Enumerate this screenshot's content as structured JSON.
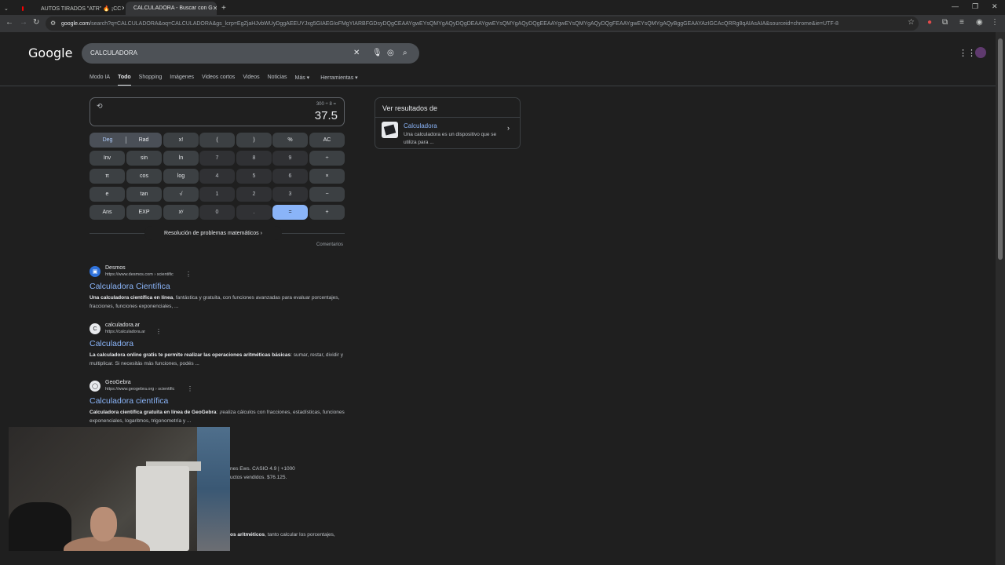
{
  "browser": {
    "tabs": [
      {
        "title": "AUTOS TIRADOS \"ATR\" 🔥 ¡CC"
      },
      {
        "title": "CALCULADORA - Buscar con G"
      }
    ],
    "url_host": "google.com",
    "url_rest": "/search?q=CALCULADORA&oq=CALCULADORA&gs_lcrp=EgZjaHJvbWUyDggAEEUYJxg5GIAEGIoFMgYIARBFGDsyDQgCEAAYgwEYsQMYgAQyDQgDEAAYgwEYsQMYgAQyDQgEEAAYgwEYsQMYgAQyDQgFEAAYgwEYsQMYgAQyBggGEAAYAzIGCAcQRRg8qAIAsAIA&sourceid=chrome&ie=UTF-8"
  },
  "search": {
    "logo": "Google",
    "query": "CALCULADORA"
  },
  "nav_tabs": [
    "Modo IA",
    "Todo",
    "Shopping",
    "Imágenes",
    "Videos cortos",
    "Videos",
    "Noticias",
    "Más ▾",
    "Herramientas ▾"
  ],
  "calculator": {
    "expression": "300 ÷ 8 =",
    "result": "37.5",
    "rows": [
      [
        "Deg",
        "Rad",
        "x!",
        "(",
        ")",
        "%",
        "AC"
      ],
      [
        "Inv",
        "sin",
        "ln",
        "7",
        "8",
        "9",
        "÷"
      ],
      [
        "π",
        "cos",
        "log",
        "4",
        "5",
        "6",
        "×"
      ],
      [
        "e",
        "tan",
        "√",
        "1",
        "2",
        "3",
        "−"
      ],
      [
        "Ans",
        "EXP",
        "xʸ",
        "0",
        ".",
        "=",
        "+"
      ]
    ],
    "solve_label": "Resolución de problemas matemáticos ›",
    "feedback_label": "Comentarios"
  },
  "side_panel": {
    "title": "Ver resultados de",
    "name": "Calculadora",
    "description": "Una calculadora es un dispositivo que se utiliza para ..."
  },
  "results": [
    {
      "site": "Desmos",
      "url": "https://www.desmos.com › scientific",
      "title": "Calculadora Científica",
      "snippet_bold": "Una calculadora científica en línea",
      "snippet_rest": ", fantástica y gratuita, con funciones avanzadas para evaluar porcentajes, fracciones, funciones exponenciales, ..."
    },
    {
      "site": "calculadora.ar",
      "url": "https://calculadora.ar",
      "title": "Calculadora",
      "snippet_bold": "La calculadora online gratis te permite realizar las operaciones aritméticas básicas",
      "snippet_rest": ": sumar, restar, dividir y multiplicar. Si necesitás más funciones, podés ..."
    },
    {
      "site": "GeoGebra",
      "url": "https://www.geogebra.org › scientific",
      "title": "Calculadora científica",
      "snippet_bold": "Calculadora científica gratuita en línea de GeoGebra",
      "snippet_rest": ": ¡realiza cálculos con fracciones, estadísticas, funciones exponenciales, logaritmos, trigonometría y ..."
    }
  ],
  "clipped_text": {
    "line1": "nes Ews. CASIO 4.9 | +1000",
    "line2": "uctos vendidos. $76.125.",
    "line3_bold": "os aritméticos",
    "line3_rest": ", tanto calcular los porcentajes,"
  }
}
